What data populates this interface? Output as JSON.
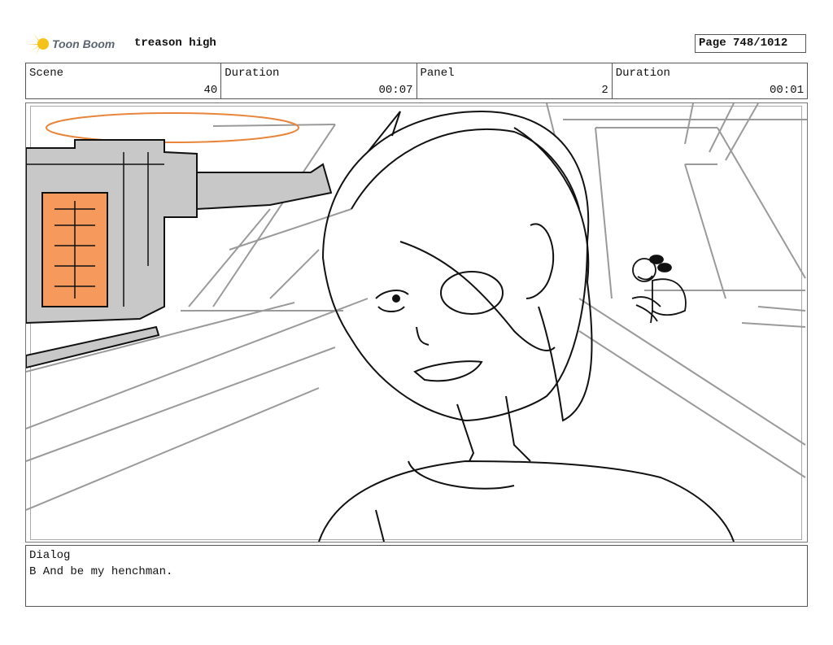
{
  "header": {
    "brand": "Toon Boom",
    "project_title": "treason high",
    "page_label": "Page",
    "page_value": "748/1012"
  },
  "info": {
    "scene_label": "Scene",
    "scene_value": "40",
    "scene_duration_label": "Duration",
    "scene_duration_value": "00:07",
    "panel_label": "Panel",
    "panel_value": "2",
    "panel_duration_label": "Duration",
    "panel_duration_value": "00:01"
  },
  "dialog": {
    "label": "Dialog",
    "text": "B And be my henchman."
  },
  "colors": {
    "accent_orange": "#f59a5c",
    "line_orange": "#e8853a",
    "machine_gray": "#c8c8c8",
    "logo_yellow": "#f6c21a"
  }
}
